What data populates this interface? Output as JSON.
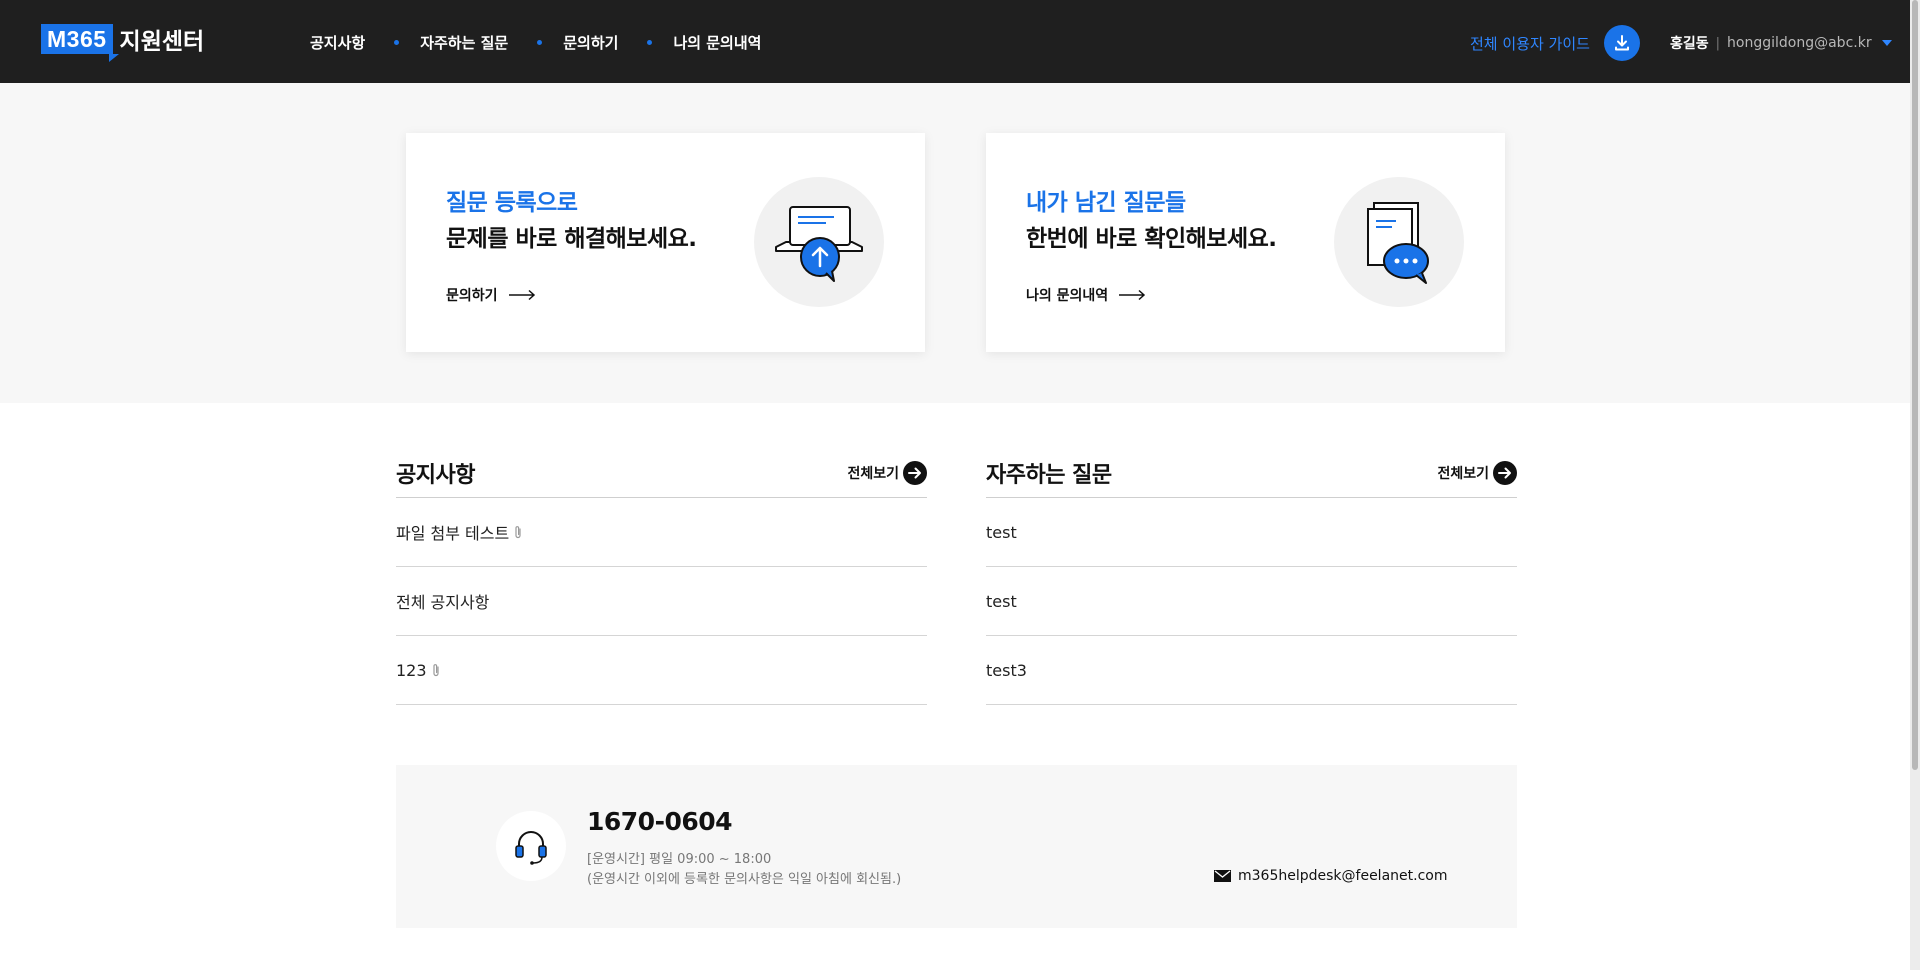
{
  "header": {
    "logo_badge": "M365",
    "logo_text": "지원센터",
    "nav": [
      "공지사항",
      "자주하는 질문",
      "문의하기",
      "나의 문의내역"
    ],
    "guide_label": "전체 이용자 가이드",
    "user_name": "홍길동",
    "user_separator": "|",
    "user_email": "honggildong@abc.kr"
  },
  "hero": {
    "cards": [
      {
        "accent": "질문 등록으로",
        "title": "문제를 바로 해결해보세요.",
        "link": "문의하기",
        "icon": "upload-chat-icon"
      },
      {
        "accent": "내가 남긴 질문들",
        "title": "한번에 바로 확인해보세요.",
        "link": "나의 문의내역",
        "icon": "documents-chat-icon"
      }
    ]
  },
  "notices": {
    "title": "공지사항",
    "more_label": "전체보기",
    "items": [
      {
        "text": "파일 첨부 테스트",
        "attachment": true
      },
      {
        "text": "전체 공지사항",
        "attachment": false
      },
      {
        "text": "123",
        "attachment": true
      }
    ]
  },
  "faq": {
    "title": "자주하는 질문",
    "more_label": "전체보기",
    "items": [
      {
        "text": "test"
      },
      {
        "text": "test"
      },
      {
        "text": "test3"
      }
    ]
  },
  "contact": {
    "phone": "1670-0604",
    "hours": "[운영시간] 평일 09:00 ~ 18:00",
    "hours_note": "(운영시간 이외에 등록한 문의사항은 익일 아침에 회신됨.)",
    "email": "m365helpdesk@feelanet.com"
  },
  "colors": {
    "brand": "#1a73e8",
    "header_bg": "#1f1f1f",
    "section_bg": "#f7f7f7"
  }
}
